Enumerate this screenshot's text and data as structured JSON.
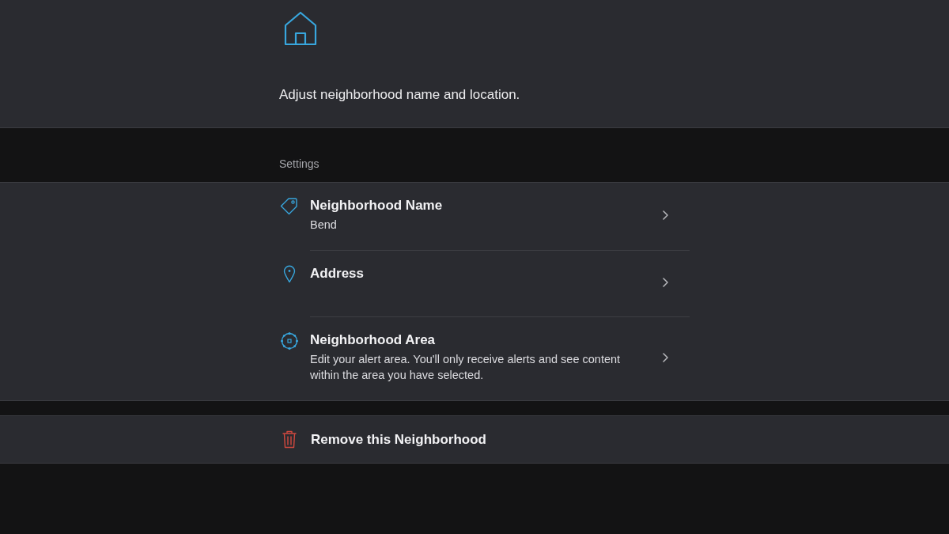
{
  "header": {
    "description": "Adjust neighborhood name and location."
  },
  "section": {
    "title": "Settings"
  },
  "settings": [
    {
      "title": "Neighborhood Name",
      "subtitle": "Bend"
    },
    {
      "title": "Address"
    },
    {
      "title": "Neighborhood Area",
      "subtitle": "Edit your alert area. You'll only receive alerts and see content within the area you have selected."
    }
  ],
  "remove_action": {
    "label": "Remove this Neighborhood"
  }
}
